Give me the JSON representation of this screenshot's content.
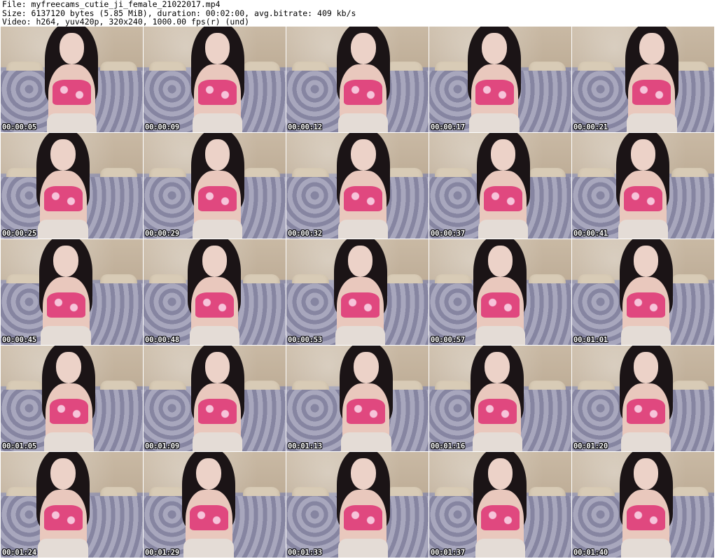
{
  "header": {
    "file_line": "File: myfreecams_cutie_ji_female_21022017.mp4",
    "size_line": "Size: 6137120 bytes (5.85 MiB), duration: 00:02:00, avg.bitrate: 409 kb/s",
    "video_line": "Video: h264, yuv420p, 320x240, 1000.00 fps(r) (und)"
  },
  "thumbnails": [
    {
      "timestamp": "00:00:05"
    },
    {
      "timestamp": "00:00:09"
    },
    {
      "timestamp": "00:00:12"
    },
    {
      "timestamp": "00:00:17"
    },
    {
      "timestamp": "00:00:21"
    },
    {
      "timestamp": "00:00:25"
    },
    {
      "timestamp": "00:00:29"
    },
    {
      "timestamp": "00:00:32"
    },
    {
      "timestamp": "00:00:37"
    },
    {
      "timestamp": "00:00:41"
    },
    {
      "timestamp": "00:00:45"
    },
    {
      "timestamp": "00:00:48"
    },
    {
      "timestamp": "00:00:53"
    },
    {
      "timestamp": "00:00:57"
    },
    {
      "timestamp": "00:01:01"
    },
    {
      "timestamp": "00:01:05"
    },
    {
      "timestamp": "00:01:09"
    },
    {
      "timestamp": "00:01:13"
    },
    {
      "timestamp": "00:01:16"
    },
    {
      "timestamp": "00:01:20"
    },
    {
      "timestamp": "00:01:24"
    },
    {
      "timestamp": "00:01:29"
    },
    {
      "timestamp": "00:01:33"
    },
    {
      "timestamp": "00:01:37"
    },
    {
      "timestamp": "00:01:40"
    }
  ]
}
